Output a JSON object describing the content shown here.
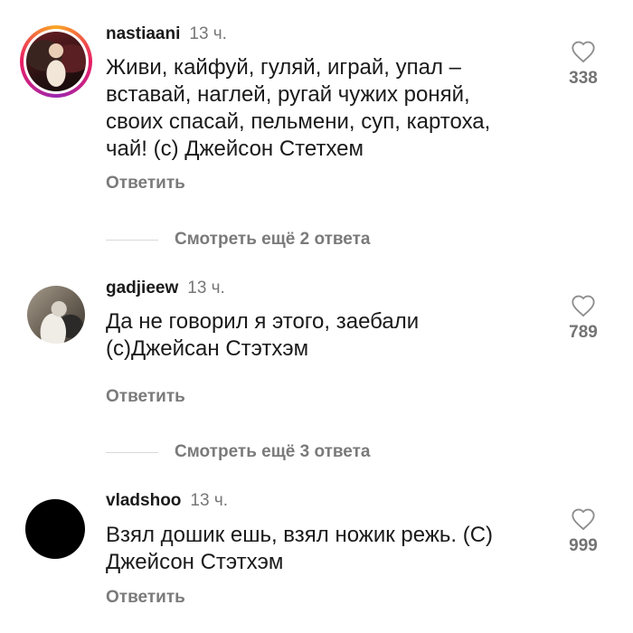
{
  "comments": [
    {
      "username": "nastiaani",
      "time": "13 ч.",
      "text": "Живи, кайфуй, гуляй, играй, упал –\nвставай, наглей, ругай чужих роняй,\nсвоих спасай, пельмени, суп, картоха,\nчай! (с) Джейсон Стетхем",
      "reply_label": "Ответить",
      "likes": "338",
      "view_replies": "Смотреть ещё 2 ответа"
    },
    {
      "username": "gadjieew",
      "time": "13 ч.",
      "text": "Да не говорил я этого, заебали\n(с)Джейсан Стэтхэм",
      "reply_label": "Ответить",
      "likes": "789",
      "view_replies": "Смотреть ещё 3 ответа"
    },
    {
      "username": "vladshoo",
      "time": "13 ч.",
      "text": "Взял дошик ешь, взял ножик режь. (С)\nДжейсон Стэтхэм",
      "reply_label": "Ответить",
      "likes": "999"
    }
  ],
  "colors": {
    "text": "#1a1a1a",
    "muted": "#777777",
    "story_ring": "#e91e63"
  },
  "icons": {
    "like": "heart-outline-icon"
  }
}
